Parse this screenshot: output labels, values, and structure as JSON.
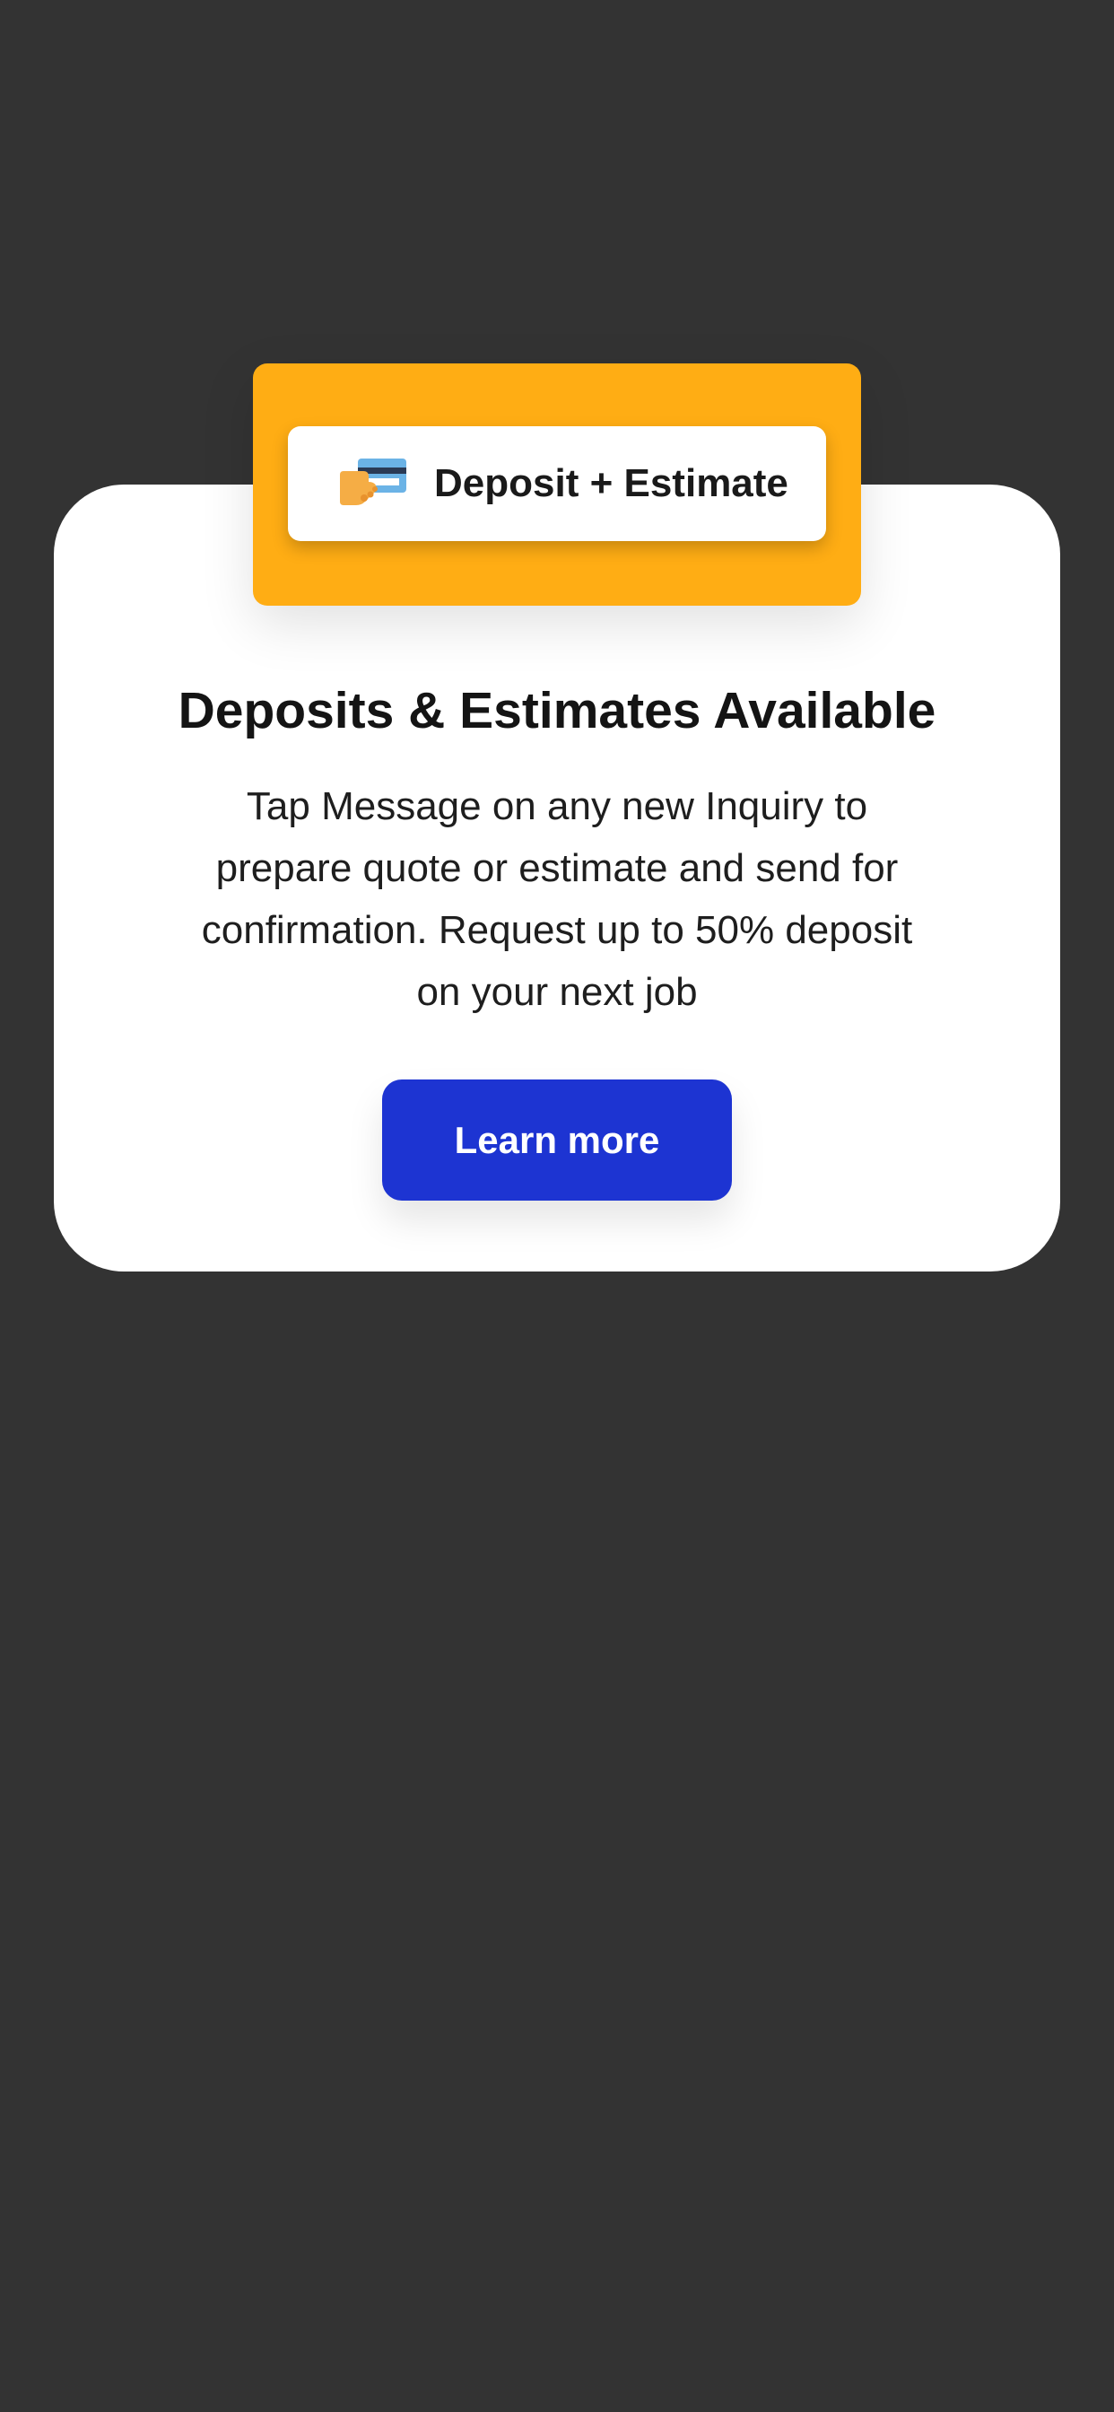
{
  "hero": {
    "chip_label": "Deposit + Estimate",
    "icon": "hand-holding-credit-card-icon",
    "background_color": "#ffad14"
  },
  "card": {
    "title": "Deposits & Estimates Available",
    "body": "Tap Message on any new Inquiry to\nprepare quote or estimate and send  for\nconfirmation. Request up to 50% deposit\non your next job"
  },
  "cta": {
    "label": "Learn more",
    "color": "#1d34d2"
  },
  "colors": {
    "page_background": "#333333",
    "card_background": "#ffffff"
  }
}
